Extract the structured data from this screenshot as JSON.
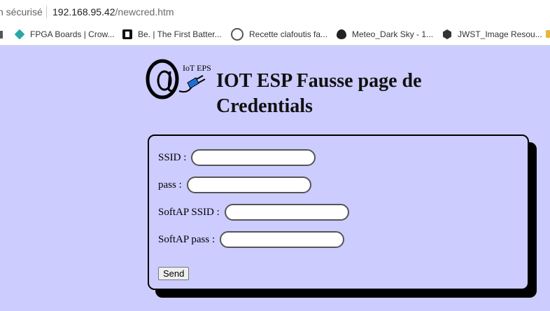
{
  "browser": {
    "security_text": "n sécurisé",
    "url_host": "192.168.95.42",
    "url_path": "/newcred.htm",
    "bookmarks": [
      {
        "label": "FPGA Boards | Crow...",
        "icon": "fpga-icon"
      },
      {
        "label": "Be. | The First Batter...",
        "icon": "be-icon"
      },
      {
        "label": "Recette clafoutis fa...",
        "icon": "recipe-icon"
      },
      {
        "label": "Meteo_Dark Sky - 1...",
        "icon": "meteo-icon"
      },
      {
        "label": "JWST_Image Resou...",
        "icon": "jwst-icon"
      }
    ]
  },
  "page": {
    "logo_text": "IoT EPS",
    "title": "IOT ESP Fausse page de Credentials",
    "form": {
      "ssid_label": "SSID :",
      "ssid_value": "",
      "pass_label": "pass :",
      "pass_value": "",
      "softap_ssid_label": "SoftAP SSID :",
      "softap_ssid_value": "",
      "softap_pass_label": "SoftAP pass :",
      "softap_pass_value": "",
      "send_label": "Send"
    }
  },
  "colors": {
    "page_background": "#ccccff",
    "panel_border": "#000000",
    "panel_shadow": "#000000"
  }
}
